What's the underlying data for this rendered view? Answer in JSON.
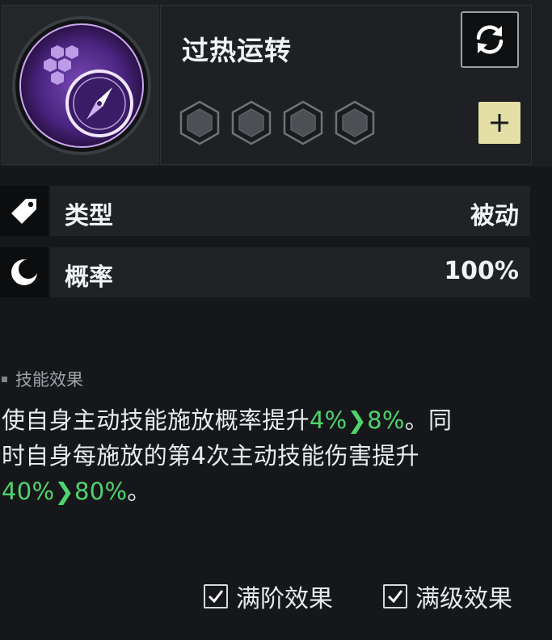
{
  "skill": {
    "name": "过热运转",
    "icon": "compass-gear-icon",
    "slots": [
      "empty-slot-icon",
      "empty-slot-icon",
      "empty-slot-icon",
      "empty-slot-icon"
    ],
    "badge_color": "#6d3fa8"
  },
  "actions": {
    "refresh_icon": "refresh-icon",
    "add_icon": "add-icon"
  },
  "stats": [
    {
      "icon": "tag-icon",
      "label": "类型",
      "value": "被动"
    },
    {
      "icon": "moon-icon",
      "label": "概率",
      "value": "100%"
    }
  ],
  "effect": {
    "title": "技能效果",
    "line1_text": "使自身主动技能施放概率提升",
    "line1_from": "4%",
    "line1_arrow": "❯",
    "line1_to": "8%",
    "line1_end": "。同",
    "line2_text": "时自身每施放的第4次主动技能伤害提升",
    "line3_from": "40%",
    "line3_arrow": "❯",
    "line3_to": "80%",
    "line3_end": "。"
  },
  "toggles": [
    {
      "label": "满阶效果",
      "checked": true
    },
    {
      "label": "满级效果",
      "checked": true
    }
  ],
  "colors": {
    "highlight": "#4fd56d",
    "add_button": "#e3dfa6"
  }
}
